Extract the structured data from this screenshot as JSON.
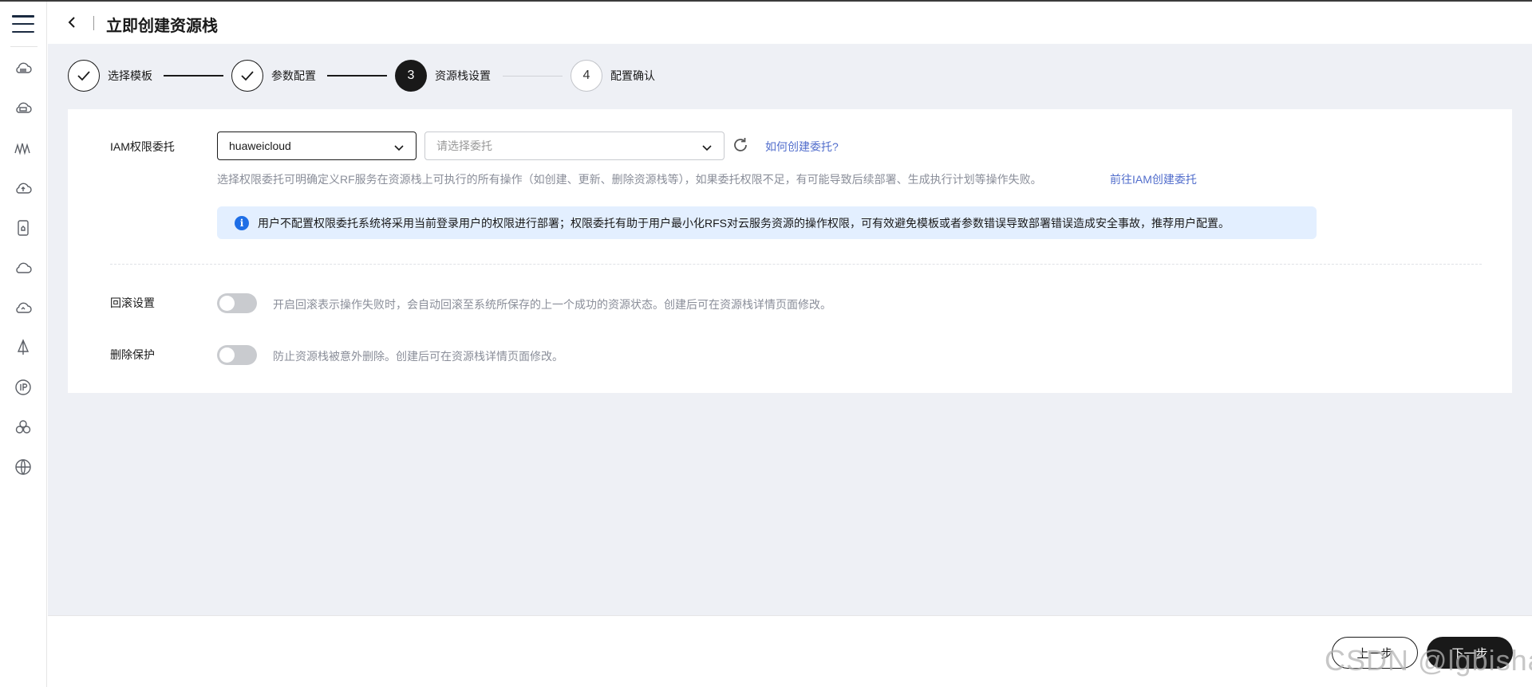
{
  "header": {
    "title": "立即创建资源栈"
  },
  "steps": [
    {
      "label": "选择模板",
      "state": "done"
    },
    {
      "label": "参数配置",
      "state": "done"
    },
    {
      "number": "3",
      "label": "资源栈设置",
      "state": "current"
    },
    {
      "number": "4",
      "label": "配置确认",
      "state": "todo"
    }
  ],
  "sidebar": {
    "icons": [
      "cloud-server-icon",
      "cloud-database-icon",
      "monitor-wave-icon",
      "cloud-upload-icon",
      "storage-device-icon",
      "cloud-icon",
      "cloud-sync-icon",
      "network-node-icon",
      "ip-icon",
      "cluster-icon",
      "globe-icon"
    ]
  },
  "iam": {
    "label": "IAM权限委托",
    "provider_value": "huaweicloud",
    "agency_placeholder": "请选择委托",
    "how_to_link": "如何创建委托?",
    "help_text": "选择权限委托可明确定义RF服务在资源栈上可执行的所有操作（如创建、更新、删除资源栈等），如果委托权限不足，有可能导致后续部署、生成执行计划等操作失败。",
    "iam_link": "前往IAM创建委托",
    "notice": "用户不配置权限委托系统将采用当前登录用户的权限进行部署；权限委托有助于用户最小化RFS对云服务资源的操作权限，可有效避免模板或者参数错误导致部署错误造成安全事故，推荐用户配置。"
  },
  "rollback": {
    "label": "回滚设置",
    "enabled": false,
    "description": "开启回滚表示操作失败时，会自动回滚至系统所保存的上一个成功的资源状态。创建后可在资源栈详情页面修改。"
  },
  "delete_protection": {
    "label": "删除保护",
    "enabled": false,
    "description": "防止资源栈被意外删除。创建后可在资源栈详情页面修改。"
  },
  "footer": {
    "prev_label": "上一步",
    "next_label": "下一步"
  },
  "watermark": "CSDN @lgbisha",
  "colors": {
    "accent": "#191919",
    "link": "#526ecc",
    "notice_bg": "#e3efff",
    "info_icon": "#1e6ee6",
    "page_bg": "#eef0f5"
  }
}
